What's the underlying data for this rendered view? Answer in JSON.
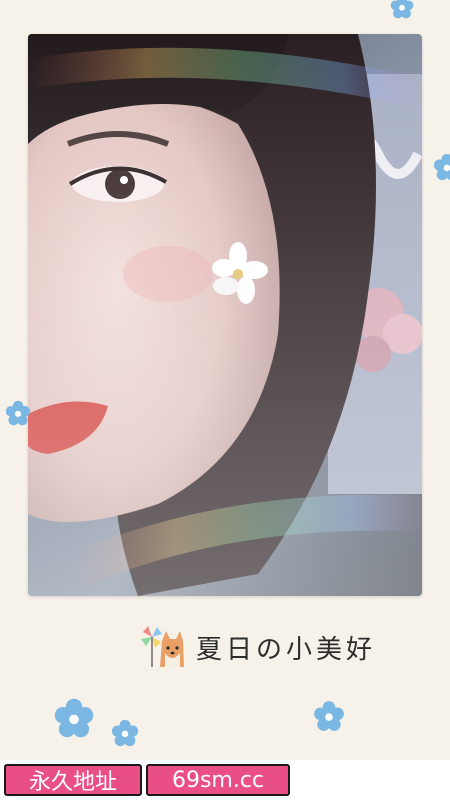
{
  "caption": {
    "text": "夏日の小美好",
    "icon": "cartoon-dog-pinwheel-icon"
  },
  "bottom_links": [
    {
      "label": "永久地址"
    },
    {
      "label": "69sm.cc"
    }
  ],
  "colors": {
    "background": "#f6f2ea",
    "link_button": "#e94f86",
    "flower": "#7bb7e3"
  }
}
